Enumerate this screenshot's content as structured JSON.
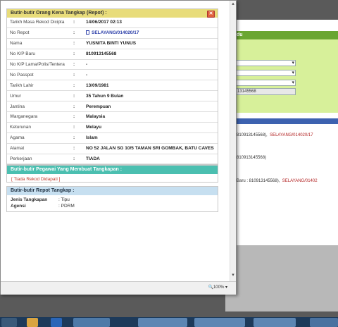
{
  "popup": {
    "section1_title": "Butir-butir Orang Kena Tangkap (Repot) :",
    "rows": [
      {
        "label": "Tarikh Masa Rekod Dicipta",
        "value": "14/06/2017 02:13"
      },
      {
        "label": "No Repot",
        "value": "SELAYANG/014020/17"
      },
      {
        "label": "Nama",
        "value": "YUSNITA BINTI YUNUS"
      },
      {
        "label": "No K/P Baru",
        "value": "810913145568"
      },
      {
        "label": "No K/P Lama/Polis/Tentera",
        "value": "-"
      },
      {
        "label": "No Passpot",
        "value": "-"
      },
      {
        "label": "Tarikh Lahir",
        "value": "13/09/1981"
      },
      {
        "label": "Umur",
        "value": "35 Tahun 9 Bulan"
      },
      {
        "label": "Jantina",
        "value": "Perempuan"
      },
      {
        "label": "Warganegara",
        "value": "Malaysia"
      },
      {
        "label": "Keturunan",
        "value": "Melayu"
      },
      {
        "label": "Agama",
        "value": "Islam"
      },
      {
        "label": "Alamat",
        "value": "NO 52 JALAN SG 10/5 TAMAN SRI GOMBAK, BATU CAVES"
      },
      {
        "label": "Perkerjaan",
        "value": "TIADA"
      }
    ],
    "separator": ":",
    "section2_title": "Butir-butir Pegawai Yang Membuat Tangkapan :",
    "section2_empty": "[ Tiada Rekod Didapati ]",
    "section3_title": "Butir-butir Repot Tangkap :",
    "section3_rows": [
      {
        "label": "Jenis Tangkapan",
        "value": ": Tipu"
      },
      {
        "label": "Agensi",
        "value": ": PDRM"
      }
    ],
    "close_symbol": "✕",
    "zoom": "100%"
  },
  "background": {
    "header_fragment": "idu",
    "input_value": "13145568",
    "line1_prefix": "810913145568),",
    "line1_link": "SELAYANG/014020/17",
    "line2": "810913145568)",
    "line3_prefix": "Baru : 810913145568),",
    "line3_link": "SELAYANG/01402"
  }
}
